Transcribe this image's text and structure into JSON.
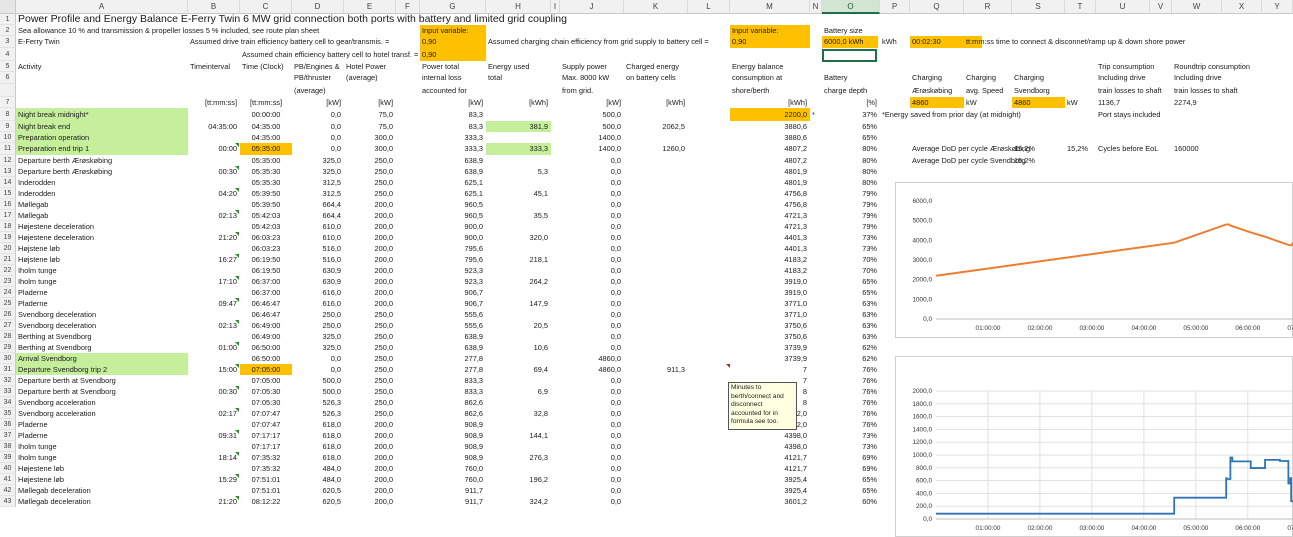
{
  "columns": [
    "A",
    "B",
    "C",
    "D",
    "E",
    "F",
    "G",
    "H",
    "I",
    "J",
    "K",
    "L",
    "M",
    "N",
    "O",
    "P",
    "Q",
    "R",
    "S",
    "T",
    "U",
    "V",
    "W",
    "X",
    "Y"
  ],
  "selected_column": "O",
  "rows": [
    {
      "n": "1",
      "cells": {
        "A": "Power Profile and Energy Balance E-Ferry Twin 6 MW grid connection both ports with battery and limited grid coupling"
      }
    },
    {
      "n": "2",
      "cells": {
        "A": "Sea allowance 10 % and transmission & propeller losses 5 % included, see route plan sheet",
        "G": "Input variable:",
        "M": "Input variable:",
        "O": "Battery size"
      }
    },
    {
      "n": "3",
      "cells": {
        "A": "E-Ferry Twin",
        "B": "Assumed drive train efficiency battery cell to gear/transmis. =",
        "G": "0,90",
        "H": "Assumed charging chain efficiency from grid supply to battery cell =",
        "M": "0,90",
        "O": "6000,0 kWh",
        "P": "kWh",
        "Q": "00:02:30",
        "R": "tt:mm:ss time to connect & disconnet/ramp up & down shore power"
      }
    },
    {
      "n": "4",
      "cells": {
        "C": "Assumed chain efficiency battery cell to hotel transf. =",
        "G": "0,90"
      }
    },
    {
      "n": "5",
      "cells": {
        "A": "Activity",
        "B": "Timeinterval",
        "C": "Time (Clock)",
        "D": "PB/Engines &",
        "E": "Hotel Power",
        "G": "Power total",
        "H": "Energy used",
        "J": "Supply power",
        "K": "Charged energy",
        "M": "Energy balance",
        "U": "Trip consumption",
        "W": "Roundtrip consumption"
      }
    },
    {
      "n": "6",
      "cells": {
        "D": "PB/thruster",
        "E": "(average)",
        "G": "internal loss",
        "H": "total",
        "J": "Max. 8000 kW",
        "K": "on battery cells",
        "M": "consumption at",
        "O": "Battery",
        "Q": "Charging",
        "R": "Charging",
        "S": "Charging",
        "U": "Including drive",
        "W": "Including drive"
      }
    },
    {
      "n": "6b",
      "cells": {
        "D": "(average)",
        "G": "accounted for",
        "J": "from grid.",
        "M": "shore/berth",
        "O": "charge depth",
        "Q": "Ærøskøbing",
        "R": "avg. Speed",
        "S": "Svendborg",
        "U": "train losses to shaft",
        "W": "train losses to shaft"
      }
    },
    {
      "n": "7",
      "cells": {
        "B": "[tt:mm:ss]",
        "C": "[tt:mm:ss]",
        "D": "[kW]",
        "E": "[kW]",
        "G": "[kW]",
        "H": "[kWh]",
        "J": "[kW]",
        "K": "[kWh]",
        "M": "[kWh]",
        "O": "[%]",
        "Q": "4860",
        "R": "kW",
        "S": "4860",
        "T": "kW",
        "U": "1136,7",
        "W": "2274,9"
      }
    },
    {
      "n": "8",
      "cells": {
        "A": "Night break midnight*",
        "C": "00:00:00",
        "D": "0,0",
        "E": "75,0",
        "G": "83,3",
        "J": "500,0",
        "M": "2200,0",
        "N": "*",
        "O": "37%",
        "P": "*Energy saved from prior day (at midnight)",
        "U": "Port stays included"
      }
    },
    {
      "n": "9",
      "cells": {
        "A": "Night break end",
        "B": "04:35:00",
        "C": "04:35:00",
        "D": "0,0",
        "E": "75,0",
        "G": "83,3",
        "H": "381,9",
        "J": "500,0",
        "K": "2062,5",
        "M": "3880,6",
        "O": "65%"
      }
    },
    {
      "n": "10",
      "cells": {
        "A": "Preparation operation",
        "C": "04:35:00",
        "D": "0,0",
        "E": "300,0",
        "G": "333,3",
        "J": "1400,0",
        "M": "3880,6",
        "O": "65%"
      }
    },
    {
      "n": "11",
      "cells": {
        "A": "Preparation end trip 1",
        "B": "00:00",
        "C": "05:35:00",
        "D": "0,0",
        "E": "300,0",
        "G": "333,3",
        "H": "333,3",
        "J": "1400,0",
        "K": "1260,0",
        "M": "4807,2",
        "O": "80%",
        "Q": "Average DoD per cycle Ærøskøbing",
        "S": "15,2%",
        "T": "15,2%",
        "U": "Cycles before EoL",
        "W": "160000"
      }
    },
    {
      "n": "12",
      "cells": {
        "A": "Departure berth Ærøskøbing",
        "C": "05:35:00",
        "D": "325,0",
        "E": "250,0",
        "G": "638,9",
        "J": "0,0",
        "M": "4807,2",
        "O": "80%",
        "Q": "Average DoD per cycle Svendborg",
        "S": "15,2%"
      }
    },
    {
      "n": "13",
      "cells": {
        "A": "Departure berth Ærøskøbing",
        "B": "00:30",
        "C": "05:35:30",
        "D": "325,0",
        "E": "250,0",
        "G": "638,9",
        "H": "5,3",
        "J": "0,0",
        "M": "4801,9",
        "O": "80%"
      }
    },
    {
      "n": "14",
      "cells": {
        "A": "Inderodden",
        "C": "05:35:30",
        "D": "312,5",
        "E": "250,0",
        "G": "625,1",
        "J": "0,0",
        "M": "4801,9",
        "O": "80%"
      }
    },
    {
      "n": "15",
      "cells": {
        "A": "Inderodden",
        "B": "04:20",
        "C": "05:39:50",
        "D": "312,5",
        "E": "250,0",
        "G": "625,1",
        "H": "45,1",
        "J": "0,0",
        "M": "4756,8",
        "O": "79%"
      }
    },
    {
      "n": "16",
      "cells": {
        "A": "Møllegab",
        "C": "05:39:50",
        "D": "664,4",
        "E": "200,0",
        "G": "960,5",
        "J": "0,0",
        "M": "4756,8",
        "O": "79%"
      }
    },
    {
      "n": "17",
      "cells": {
        "A": "Møllegab",
        "B": "02:13",
        "C": "05:42:03",
        "D": "664,4",
        "E": "200,0",
        "G": "960,5",
        "H": "35,5",
        "J": "0,0",
        "M": "4721,3",
        "O": "79%"
      }
    },
    {
      "n": "18",
      "cells": {
        "A": "Højestene deceleration",
        "C": "05:42:03",
        "D": "610,0",
        "E": "200,0",
        "G": "900,0",
        "J": "0,0",
        "M": "4721,3",
        "O": "79%"
      }
    },
    {
      "n": "19",
      "cells": {
        "A": "Højestene deceleration",
        "B": "21:20",
        "C": "06:03:23",
        "D": "610,0",
        "E": "200,0",
        "G": "900,0",
        "H": "320,0",
        "J": "0,0",
        "M": "4401,3",
        "O": "73%"
      }
    },
    {
      "n": "20",
      "cells": {
        "A": "Højstene løb",
        "C": "06:03:23",
        "D": "516,0",
        "E": "200,0",
        "G": "795,6",
        "J": "0,0",
        "M": "4401,3",
        "O": "73%"
      }
    },
    {
      "n": "21",
      "cells": {
        "A": "Højstene løb",
        "B": "16:27",
        "C": "06:19:50",
        "D": "516,0",
        "E": "200,0",
        "G": "795,6",
        "H": "218,1",
        "J": "0,0",
        "M": "4183,2",
        "O": "70%"
      }
    },
    {
      "n": "22",
      "cells": {
        "A": "Iholm tunge",
        "C": "06:19:50",
        "D": "630,9",
        "E": "200,0",
        "G": "923,3",
        "J": "0,0",
        "M": "4183,2",
        "O": "70%"
      }
    },
    {
      "n": "23",
      "cells": {
        "A": "Iholm tunge",
        "B": "17:10",
        "C": "06:37:00",
        "D": "630,9",
        "E": "200,0",
        "G": "923,3",
        "H": "264,2",
        "J": "0,0",
        "M": "3919,0",
        "O": "65%"
      }
    },
    {
      "n": "24",
      "cells": {
        "A": "Pladerne",
        "C": "06:37:00",
        "D": "616,0",
        "E": "200,0",
        "G": "906,7",
        "J": "0,0",
        "M": "3919,0",
        "O": "65%"
      }
    },
    {
      "n": "25",
      "cells": {
        "A": "Pladerne",
        "B": "09:47",
        "C": "06:46:47",
        "D": "616,0",
        "E": "200,0",
        "G": "906,7",
        "H": "147,9",
        "J": "0,0",
        "M": "3771,0",
        "O": "63%"
      }
    },
    {
      "n": "26",
      "cells": {
        "A": "Svendborg deceleration",
        "C": "06:46:47",
        "D": "250,0",
        "E": "250,0",
        "G": "555,6",
        "J": "0,0",
        "M": "3771,0",
        "O": "63%"
      }
    },
    {
      "n": "27",
      "cells": {
        "A": "Svendborg deceleration",
        "B": "02:13",
        "C": "06:49:00",
        "D": "250,0",
        "E": "250,0",
        "G": "555,6",
        "H": "20,5",
        "J": "0,0",
        "M": "3750,6",
        "O": "63%"
      }
    },
    {
      "n": "28",
      "cells": {
        "A": "Berthing at Svendborg",
        "C": "06:49:00",
        "D": "325,0",
        "E": "250,0",
        "G": "638,9",
        "J": "0,0",
        "M": "3750,6",
        "O": "63%"
      }
    },
    {
      "n": "29",
      "cells": {
        "A": "Berthing at Svendborg",
        "B": "01:00",
        "C": "06:50:00",
        "D": "325,0",
        "E": "250,0",
        "G": "638,9",
        "H": "10,6",
        "J": "0,0",
        "M": "3739,9",
        "O": "62%"
      }
    },
    {
      "n": "30",
      "cells": {
        "A": "Arrival Svendborg",
        "C": "06:50:00",
        "D": "0,0",
        "E": "250,0",
        "G": "277,8",
        "J": "4860,0",
        "M": "3739,9",
        "O": "62%"
      }
    },
    {
      "n": "31",
      "cells": {
        "A": "Departure Svendborg trip 2",
        "B": "15:00",
        "C": "07:05:00",
        "D": "0,0",
        "E": "250,0",
        "G": "277,8",
        "H": "69,4",
        "J": "4860,0",
        "K": "911,3",
        "M": "7",
        "O": "76%"
      }
    },
    {
      "n": "32",
      "cells": {
        "A": "Departure berth at Svendborg",
        "C": "07:05:00",
        "D": "500,0",
        "E": "250,0",
        "G": "833,3",
        "J": "0,0",
        "M": "7",
        "O": "76%"
      }
    },
    {
      "n": "33",
      "cells": {
        "A": "Departure berth at Svendborg",
        "B": "00:30",
        "C": "07:05:30",
        "D": "500,0",
        "E": "250,0",
        "G": "833,3",
        "H": "6,9",
        "J": "0,0",
        "M": "8",
        "O": "76%"
      }
    },
    {
      "n": "34",
      "cells": {
        "A": "Svendborg acceleration",
        "C": "07:05:30",
        "D": "526,3",
        "E": "250,0",
        "G": "862,6",
        "J": "0,0",
        "M": "8",
        "O": "76%"
      }
    },
    {
      "n": "35",
      "cells": {
        "A": "Svendborg acceleration",
        "B": "02:17",
        "C": "07:07:47",
        "D": "526,3",
        "E": "250,0",
        "G": "862,6",
        "H": "32,8",
        "J": "0,0",
        "M": "4542,0",
        "O": "76%"
      }
    },
    {
      "n": "36",
      "cells": {
        "A": "Pladerne",
        "C": "07:07:47",
        "D": "618,0",
        "E": "200,0",
        "G": "908,9",
        "J": "0,0",
        "M": "4542,0",
        "O": "76%"
      }
    },
    {
      "n": "37",
      "cells": {
        "A": "Pladerne",
        "B": "09:31",
        "C": "07:17:17",
        "D": "618,0",
        "E": "200,0",
        "G": "908,9",
        "H": "144,1",
        "J": "0,0",
        "M": "4398,0",
        "O": "73%"
      }
    },
    {
      "n": "38",
      "cells": {
        "A": "Iholm tunge",
        "C": "07:17:17",
        "D": "618,0",
        "E": "200,0",
        "G": "908,9",
        "J": "0,0",
        "M": "4398,0",
        "O": "73%"
      }
    },
    {
      "n": "39",
      "cells": {
        "A": "Iholm tunge",
        "B": "18:14",
        "C": "07:35:32",
        "D": "618,0",
        "E": "200,0",
        "G": "908,9",
        "H": "276,3",
        "J": "0,0",
        "M": "4121,7",
        "O": "69%"
      }
    },
    {
      "n": "40",
      "cells": {
        "A": "Højestene løb",
        "C": "07:35:32",
        "D": "484,0",
        "E": "200,0",
        "G": "760,0",
        "J": "0,0",
        "M": "4121,7",
        "O": "69%"
      }
    },
    {
      "n": "41",
      "cells": {
        "A": "Højestene løb",
        "B": "15:29",
        "C": "07:51:01",
        "D": "484,0",
        "E": "200,0",
        "G": "760,0",
        "H": "196,2",
        "J": "0,0",
        "M": "3925,4",
        "O": "65%"
      }
    },
    {
      "n": "42",
      "cells": {
        "A": "Møllegab deceleration",
        "C": "07:51:01",
        "D": "620,5",
        "E": "200,0",
        "G": "911,7",
        "J": "0,0",
        "M": "3925,4",
        "O": "65%"
      }
    },
    {
      "n": "43",
      "cells": {
        "A": "Møllegab deceleration",
        "B": "21:20",
        "C": "08:12:22",
        "D": "620,5",
        "E": "200,0",
        "G": "911,7",
        "H": "324,2",
        "J": "0,0",
        "M": "3601,2",
        "O": "60%"
      }
    }
  ],
  "comment": {
    "text": "Minutes to\nberth/connect and\ndisconnect\naccounted for in\nformula see too."
  },
  "colors": {
    "green": "#c6ef9c",
    "orange": "#ffc000",
    "line_orange": "#ed7d31",
    "line_blue": "#2e75b6",
    "grid": "#d9d9d9"
  },
  "chart_data": [
    {
      "type": "line",
      "title": "",
      "xlabel": "",
      "ylabel": "",
      "x_ticks": [
        "01:00:00",
        "02:00:00",
        "03:00:00",
        "04:00:00",
        "05:00:00",
        "06:00:00",
        "07:00:00"
      ],
      "y_ticks": [
        "0,0",
        "1000,0",
        "2000,0",
        "3000,0",
        "4000,0",
        "5000,0",
        "6000,0"
      ],
      "ylim": [
        0,
        6000
      ],
      "xlim_hours": [
        0,
        7.6
      ],
      "grid": false,
      "series": [
        {
          "color": "#ed7d31",
          "points": [
            [
              0,
              2200
            ],
            [
              4.583,
              3880.6
            ],
            [
              5.583,
              4807.2
            ],
            [
              5.645,
              4801.9
            ],
            [
              5.664,
              4756.8
            ],
            [
              5.701,
              4721.3
            ],
            [
              6.056,
              4401.3
            ],
            [
              6.331,
              4183.2
            ],
            [
              6.617,
              3919.0
            ],
            [
              6.78,
              3771.0
            ],
            [
              6.833,
              3739.9
            ],
            [
              7.083,
              4594.8
            ],
            [
              7.13,
              4542.0
            ],
            [
              7.288,
              4398.0
            ],
            [
              7.592,
              4121.7
            ]
          ]
        }
      ]
    },
    {
      "type": "line",
      "title": "",
      "xlabel": "",
      "ylabel": "",
      "x_ticks": [
        "01:00:00",
        "02:00:00",
        "03:00:00",
        "04:00:00",
        "05:00:00",
        "06:00:00",
        "07:00:00"
      ],
      "y_ticks": [
        "0,0",
        "200,0",
        "400,0",
        "600,0",
        "800,0",
        "1000,0",
        "1200,0",
        "1400,0",
        "1600,0",
        "1800,0",
        "2000,0"
      ],
      "ylim": [
        0,
        2000
      ],
      "xlim_hours": [
        0,
        7.6
      ],
      "grid": true,
      "series": [
        {
          "color": "#2e75b6",
          "step": true,
          "points": [
            [
              0,
              83.3
            ],
            [
              4.583,
              333.3
            ],
            [
              5.583,
              638.9
            ],
            [
              5.592,
              625.1
            ],
            [
              5.664,
              960.5
            ],
            [
              5.701,
              900
            ],
            [
              6.056,
              795.6
            ],
            [
              6.331,
              923.3
            ],
            [
              6.617,
              906.7
            ],
            [
              6.78,
              555.6
            ],
            [
              6.817,
              638.9
            ],
            [
              6.833,
              277.8
            ],
            [
              7.083,
              833.3
            ],
            [
              7.092,
              862.6
            ],
            [
              7.13,
              908.9
            ],
            [
              7.592,
              760
            ]
          ]
        }
      ]
    }
  ]
}
